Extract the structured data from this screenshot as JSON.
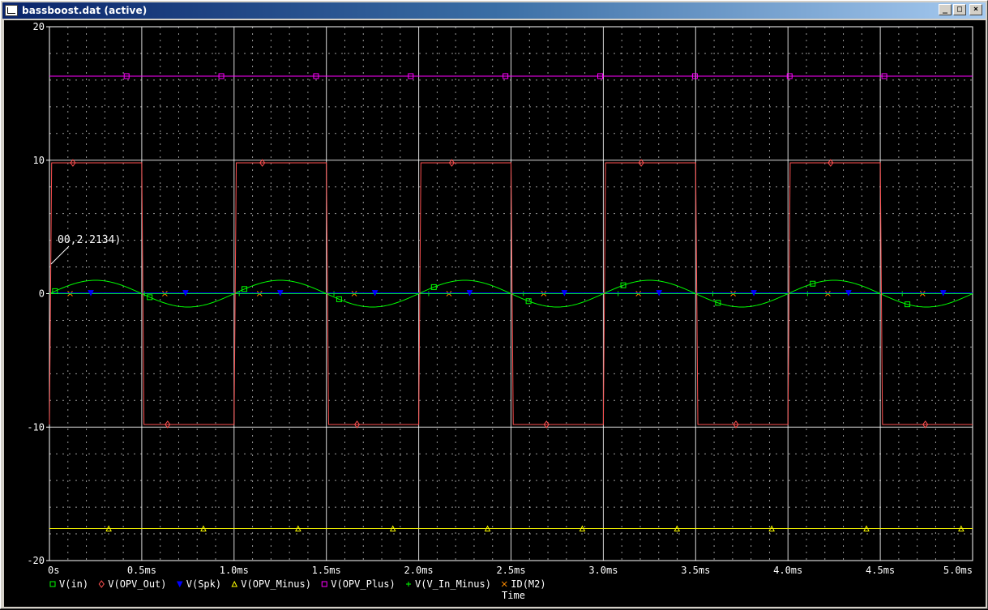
{
  "window": {
    "title": "bassboost.dat (active)",
    "buttons": {
      "minimize": "_",
      "maximize": "□",
      "close": "×"
    }
  },
  "colors": {
    "background": "#000000",
    "grid": "#ffffff",
    "axis_text": "#ffffff"
  },
  "chart_data": {
    "type": "line",
    "title": "",
    "xlabel": "Time",
    "ylabel": "",
    "xlim": [
      0,
      5
    ],
    "ylim": [
      -20,
      20
    ],
    "x_unit": "ms",
    "x_tick_labels": [
      "0s",
      "0.5ms",
      "1.0ms",
      "1.5ms",
      "2.0ms",
      "2.5ms",
      "3.0ms",
      "3.5ms",
      "4.0ms",
      "4.5ms",
      "5.0ms"
    ],
    "y_tick_labels": [
      "20",
      "10",
      "0",
      "-10",
      "-20"
    ],
    "y_tick_values": [
      20,
      10,
      0,
      -10,
      -20
    ],
    "grid": true,
    "legend_placement": "bottom",
    "annotation": {
      "text": "00,2.2134)",
      "x": 0.0,
      "y": 2.2134
    },
    "series": [
      {
        "name": "V(in)",
        "color": "#00ff00",
        "marker": "square",
        "shape": "sine",
        "amplitude": 1.0,
        "period_ms": 1.0,
        "offset": 0
      },
      {
        "name": "V(OPV_Out)",
        "color": "#ff5050",
        "marker": "diamond",
        "shape": "square-wave",
        "high": 9.8,
        "low": -9.8,
        "transitions_ms": [
          0.0,
          0.5,
          1.0,
          1.5,
          2.0,
          2.5,
          3.0,
          3.5,
          4.0,
          4.5
        ],
        "start_level": -9.8
      },
      {
        "name": "V(Spk)",
        "color": "#0000ff",
        "marker": "triangle-down",
        "shape": "constant",
        "value": 0.05
      },
      {
        "name": "V(OPV_Minus)",
        "color": "#ffff00",
        "marker": "triangle-up",
        "shape": "constant",
        "value": -17.6
      },
      {
        "name": "V(OPV_Plus)",
        "color": "#ff00ff",
        "marker": "square",
        "shape": "constant",
        "value": 16.3
      },
      {
        "name": "V(V_In_Minus)",
        "color": "#00ff00",
        "marker": "plus",
        "shape": "constant",
        "value": 0.0
      },
      {
        "name": "ID(M2)",
        "color": "#ff8c00",
        "marker": "x",
        "shape": "constant",
        "value": 0.0
      }
    ]
  }
}
